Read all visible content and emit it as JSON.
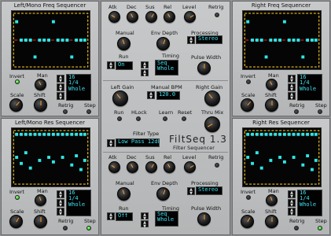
{
  "plugin": {
    "name": "FiltSeq 1.3",
    "subtitle": "Filter Sequencer"
  },
  "left_freq": {
    "title": "Left/Mono Freq Sequencer",
    "invert": "Invert",
    "man": "Man",
    "scale": "Scale",
    "shift": "Shift",
    "retrig": "Retrig",
    "step": "Step",
    "lcd": [
      "16",
      "1/4",
      "Whole"
    ]
  },
  "right_freq": {
    "title": "Right Freq Sequencer",
    "invert": "Invert",
    "man": "Man",
    "scale": "Scale",
    "shift": "Shift",
    "retrig": "Retrig",
    "step": "Step",
    "lcd": [
      "16",
      "1/4",
      "Whole"
    ]
  },
  "left_res": {
    "title": "Left/Mono Res Sequencer",
    "invert": "Invert",
    "man": "Man",
    "scale": "Scale",
    "shift": "Shift",
    "retrig": "Retrig",
    "step": "Step",
    "lcd": [
      "16",
      "1/4",
      "Whole"
    ]
  },
  "right_res": {
    "title": "Right Res Sequencer",
    "invert": "Invert",
    "man": "Man",
    "scale": "Scale",
    "shift": "Shift",
    "retrig": "Retrig",
    "step": "Step",
    "lcd": [
      "16",
      "1/4",
      "Whole"
    ]
  },
  "env1": {
    "atk": "Atk",
    "dec": "Dec",
    "sus": "Sus",
    "rel": "Rel",
    "level": "Level",
    "retrig": "Retrig",
    "manual": "Manual",
    "env_depth": "Env Depth",
    "processing": "Processing",
    "processing_value": "Stereo",
    "run": "Run",
    "run_value": "On",
    "timing": "Timing",
    "timing_value": [
      "Seq",
      "Whole"
    ],
    "pulse_width": "Pulse Width"
  },
  "mid": {
    "left_gain": "Left Gain",
    "manual_bpm": "Manual BPM",
    "bpm_value": "120.0",
    "right_gain": "Right Gain",
    "run": "Run",
    "hlock": "HLock",
    "learn": "Learn",
    "reset": "Reset",
    "thru_mix": "Thru Mix",
    "filter_type": "Filter Type",
    "filter_value": "Low Pass 12db"
  },
  "env2": {
    "atk": "Atk",
    "dec": "Dec",
    "sus": "Sus",
    "rel": "Rel",
    "level": "Level",
    "retrig": "Retrig",
    "manual": "Manual",
    "env_depth": "Env Depth",
    "processing": "Processing",
    "processing_value": "Stereo",
    "run": "Run",
    "run_value": "Off",
    "timing": "Timing",
    "timing_value": [
      "Seq",
      "Whole"
    ],
    "pulse_width": "Pulse Width"
  },
  "icons": {
    "arrows": "up-down-arrows-icon",
    "knob": "rotary-knob",
    "led": "led-indicator"
  },
  "colors": {
    "lcd_text": "#3fe0f0",
    "seq_bar": "#2ee6e6",
    "seq_dash": "#ff2020",
    "seq_border": "#f0c020",
    "led_on": "#2fd12a",
    "knob_marker": "#ff9d2e",
    "panel": "#bfc1c2"
  }
}
